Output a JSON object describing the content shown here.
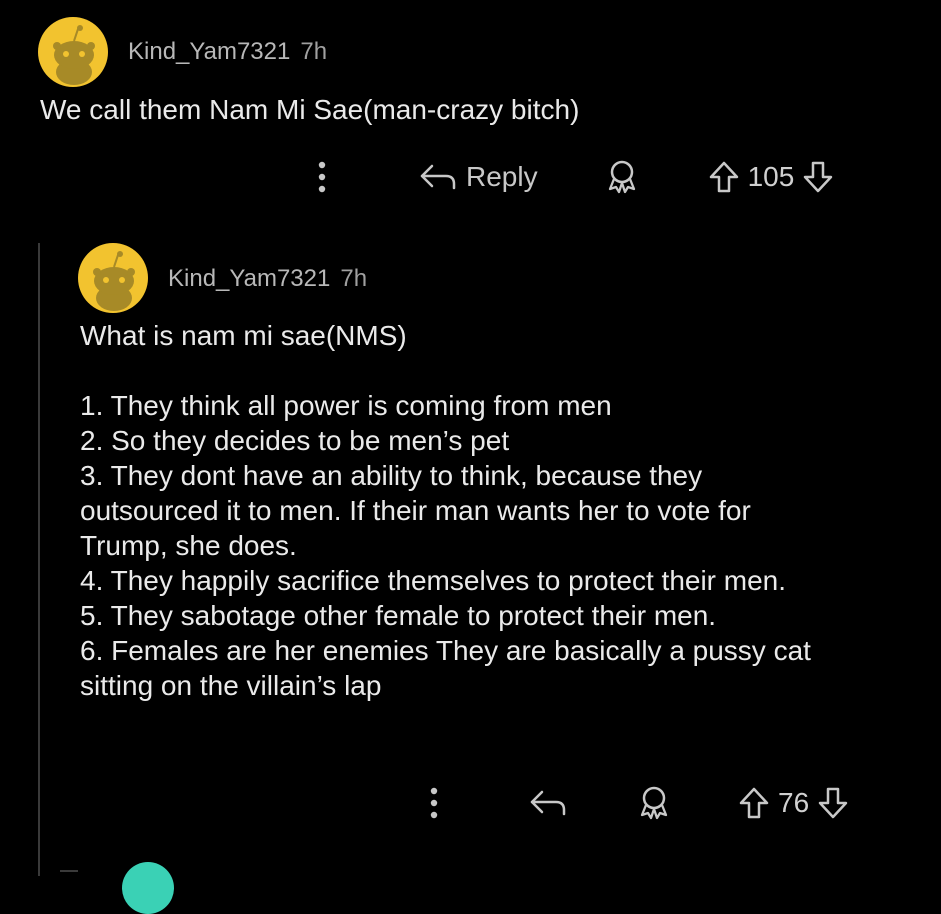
{
  "comments": [
    {
      "username": "Kind_Yam7321",
      "time": "7h",
      "text": "We call them Nam Mi Sae(man-crazy bitch)",
      "reply_label": "Reply",
      "score": "105"
    },
    {
      "username": "Kind_Yam7321",
      "time": "7h",
      "intro": "What is nam mi sae(NMS)",
      "lines": [
        "1. They think all power is coming from men",
        "2. So they decides to be men’s pet",
        "3. They dont have an ability to think, because they",
        "outsourced it to men. If their man wants her to vote for",
        "Trump, she does.",
        "4. They happily sacrifice themselves to protect their men.",
        "5. They sabotage other female to protect their men.",
        "6. Females are her enemies They are basically a pussy cat",
        "sitting on the villain’s lap"
      ],
      "score": "76"
    }
  ],
  "icons": {
    "more": "more-vertical-icon",
    "reply": "reply-arrow-icon",
    "award": "award-icon",
    "upvote": "upvote-arrow-icon",
    "downvote": "downvote-arrow-icon"
  },
  "colors": {
    "background": "#000000",
    "avatar": "#f2c32f",
    "next_avatar": "#3ad1b5",
    "thread_line": "#3a3a3a"
  }
}
